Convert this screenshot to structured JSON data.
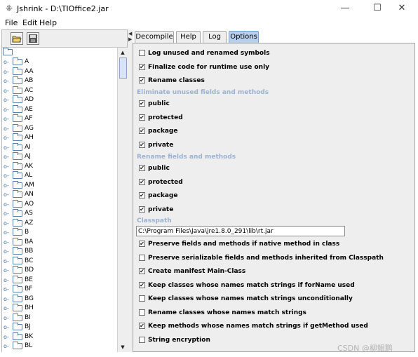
{
  "window": {
    "title": "Jshrink - D:\\TIOffice2.jar",
    "minimize": "—",
    "maximize": "☐",
    "close": "✕",
    "icon": "spinner-icon"
  },
  "menu": [
    "File",
    "Edit",
    "Help"
  ],
  "toolbar": {
    "open_icon": "open-folder-icon",
    "save_icon": "save-icon"
  },
  "tree": {
    "items": [
      "A",
      "AA",
      "AB",
      "AC",
      "AD",
      "AE",
      "AF",
      "AG",
      "AH",
      "AI",
      "AJ",
      "AK",
      "AL",
      "AM",
      "AN",
      "AO",
      "AS",
      "AZ",
      "B",
      "BA",
      "BB",
      "BC",
      "BD",
      "BE",
      "BF",
      "BG",
      "BH",
      "BI",
      "BJ",
      "BK",
      "BL"
    ]
  },
  "tabs": [
    "Decompile",
    "Help",
    "Log",
    "Options"
  ],
  "active_tab": "Options",
  "options": {
    "log_unused": {
      "label": "Log unused and renamed symbols",
      "checked": false
    },
    "finalize": {
      "label": "Finalize code for runtime use only",
      "checked": true
    },
    "rename_classes": {
      "label": "Rename classes",
      "checked": true
    },
    "eliminate_title": "Eliminate unused fields and methods",
    "eliminate": [
      {
        "label": "public",
        "checked": true
      },
      {
        "label": "protected",
        "checked": true
      },
      {
        "label": "package",
        "checked": true
      },
      {
        "label": "private",
        "checked": true
      }
    ],
    "rename_title": "Rename fields and methods",
    "rename": [
      {
        "label": "public",
        "checked": true
      },
      {
        "label": "protected",
        "checked": true
      },
      {
        "label": "package",
        "checked": true
      },
      {
        "label": "private",
        "checked": true
      }
    ],
    "classpath_title": "Classpath",
    "classpath_value": "C:\\Program Files\\Java\\jre1.8.0_291\\lib\\rt.jar",
    "bottom": [
      {
        "label": "Preserve fields and methods if native method in class",
        "checked": true
      },
      {
        "label": "Preserve serializable fields and methods inherited from Classpath",
        "checked": false
      },
      {
        "label": "Create manifest Main-Class",
        "checked": true
      },
      {
        "label": "Keep classes whose names match strings if forName used",
        "checked": true
      },
      {
        "label": "Keep classes whose names match strings unconditionally",
        "checked": false
      },
      {
        "label": "Rename classes whose names match strings",
        "checked": false
      },
      {
        "label": "Keep methods whose names match strings if getMethod used",
        "checked": true
      },
      {
        "label": "String encryption",
        "checked": false
      }
    ]
  },
  "watermark": "CSDN @柳鲲鹏"
}
